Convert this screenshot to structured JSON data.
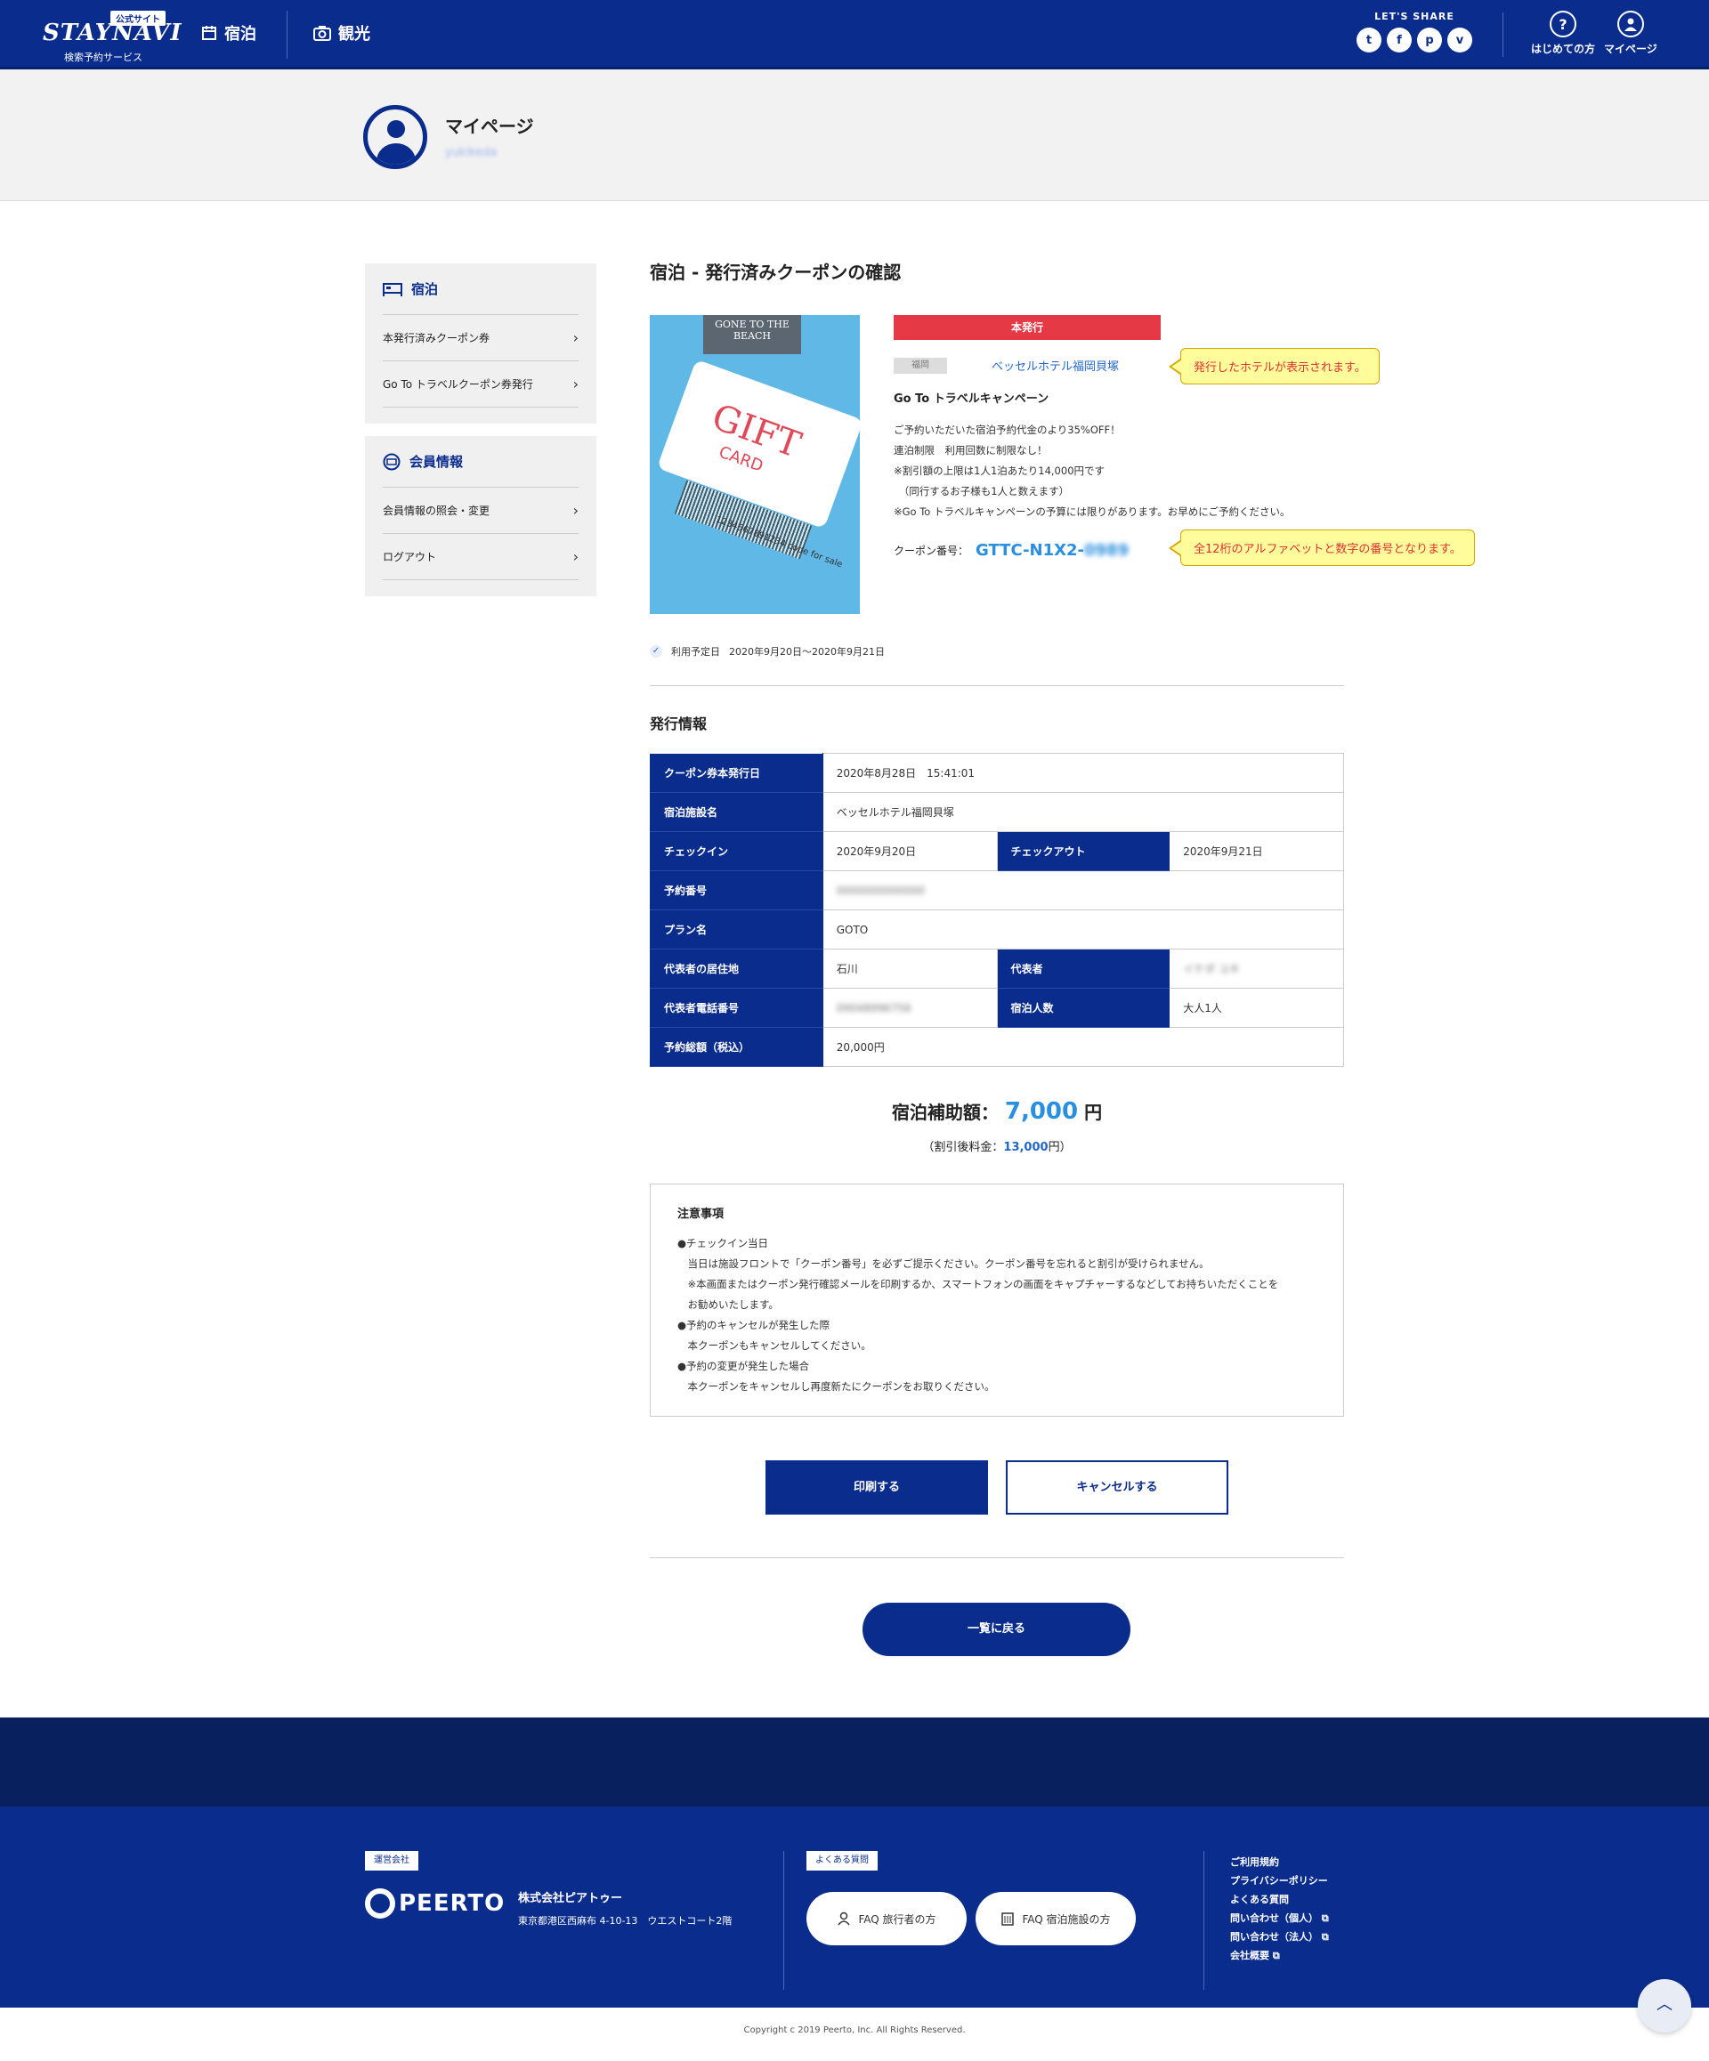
{
  "header": {
    "logo_badge": "公式サイト",
    "logo_text": "STAYNAVI",
    "logo_sub": "検索予約サービス",
    "nav": [
      {
        "label": "宿泊",
        "icon": "calendar-icon"
      },
      {
        "label": "観光",
        "icon": "camera-icon"
      }
    ],
    "share_label": "LET'S SHARE",
    "share_icons": [
      "twitter-icon",
      "facebook-icon",
      "pinterest-icon",
      "pocket-icon"
    ],
    "help_label": "はじめての方",
    "mypage_label": "マイページ"
  },
  "banner": {
    "title": "マイページ",
    "user_id": "yukikeda"
  },
  "sidebar": {
    "groups": [
      {
        "title": "宿泊",
        "items": [
          "本発行済みクーポン券",
          "Go To トラベルクーポン券発行"
        ]
      },
      {
        "title": "会員情報",
        "items": [
          "会員情報の照会・変更",
          "ログアウト"
        ]
      }
    ]
  },
  "main": {
    "title": "宿泊 - 発行済みクーポンの確認",
    "gift_image": {
      "beach_text": "GONE TO THE BEACH",
      "card_big": "GIFT",
      "card_small": "CARD",
      "barcode_text": "1234567891234 code for sale"
    },
    "status": "本発行",
    "area": "福岡",
    "hotel": "ベッセルホテル福岡貝塚",
    "campaign": "Go To トラベルキャンペーン",
    "desc": [
      "ご予約いただいた宿泊予約代金のより35%OFF！",
      "連泊制限　利用回数に制限なし！",
      "※割引額の上限は1人1泊あたり14,000円です",
      "　（同行するお子様も1人と数えます）",
      "※Go To トラベルキャンペーンの予算には限りがあります。お早めにご予約ください。"
    ],
    "coupon_label": "クーポン番号：",
    "coupon_no": "GTTC-N1X2-",
    "coupon_no_hidden": "0989",
    "callout_hotel": "発行したホテルが表示されます。",
    "callout_coupon": "全12桁のアルファベットと数字の番号となります。",
    "use_date_label": "利用予定日",
    "use_date": "2020年9月20日～2020年9月21日",
    "issue_section": "発行情報",
    "table": {
      "issued_label": "クーポン券本発行日",
      "issued": "2020年8月28日　15:41:01",
      "facility_label": "宿泊施設名",
      "facility": "ベッセルホテル福岡貝塚",
      "checkin_label": "チェックイン",
      "checkin": "2020年9月20日",
      "checkout_label": "チェックアウト",
      "checkout": "2020年9月21日",
      "resv_label": "予約番号",
      "resv": "0000000000000",
      "plan_label": "プラン名",
      "plan": "GOTO",
      "pref_label": "代表者の居住地",
      "pref": "石川",
      "rep_label": "代表者",
      "rep": "イケダ ユキ",
      "tel_label": "代表者電話番号",
      "tel": "09048996756",
      "guests_label": "宿泊人数",
      "guests": "大人1人",
      "total_label": "予約総額（税込）",
      "total": "20,000円"
    },
    "subsidy_label": "宿泊補助額：",
    "subsidy_amount": "7,000",
    "subsidy_unit": "円",
    "after_label": "（割引後料金：",
    "after_amount": "13,000",
    "after_unit": "円）",
    "notes_title": "注意事項",
    "notes": [
      "●チェックイン当日",
      "　当日は施設フロントで「クーポン番号」を必ずご提示ください。クーポン番号を忘れると割引が受けられません。",
      "　※本画面またはクーポン発行確認メールを印刷するか、スマートフォンの画面をキャプチャーするなどしてお持ちいただくことを",
      "　お勧めいたします。",
      "●予約のキャンセルが発生した際",
      "　本クーポンもキャンセルしてください。",
      "●予約の変更が発生した場合",
      "　本クーポンをキャンセルし再度新たにクーポンをお取りください。"
    ],
    "print_btn": "印刷する",
    "cancel_btn": "キャンセルする",
    "back_btn": "一覧に戻る"
  },
  "footer": {
    "operator_tag": "運営会社",
    "logo": "PEERTO",
    "company": "株式会社ピアトゥー",
    "address": "東京都港区西麻布 4-10-13　ウエストコート2階",
    "faq_tag": "よくある質問",
    "faq_traveler": "FAQ 旅行者の方",
    "faq_facility": "FAQ 宿泊施設の方",
    "links": [
      "ご利用規約",
      "プライバシーポリシー",
      "よくある質問",
      "問い合わせ（個人）",
      "問い合わせ（法人）",
      "会社概要"
    ],
    "copyright": "Copyright c 2019 Peerto, Inc. All Rights Reserved."
  },
  "colors": {
    "brand": "#0a2c8c",
    "accent": "#2a8fe0",
    "badge_red": "#e53a46",
    "callout_bg": "#fffc9c"
  }
}
